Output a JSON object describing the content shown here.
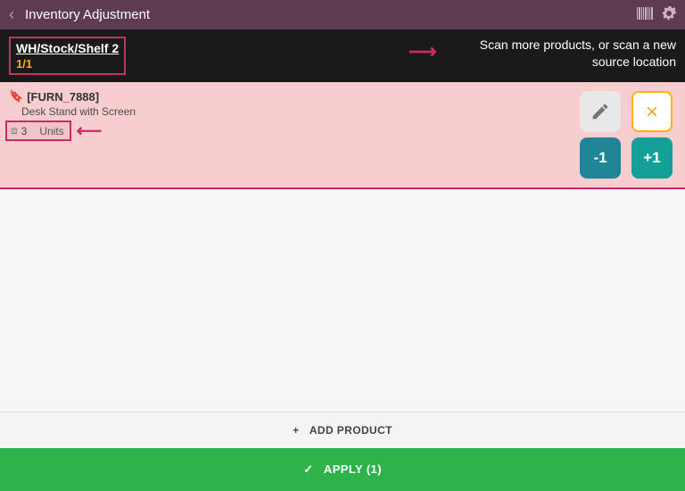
{
  "header": {
    "title": "Inventory Adjustment"
  },
  "subheader": {
    "location": "WH/Stock/Shelf 2",
    "count": "1/1",
    "scan_hint": "Scan more products, or scan a new source location"
  },
  "product": {
    "ref": "[FURN_7888]",
    "name": "Desk Stand with Screen",
    "qty": "3",
    "uom": "Units",
    "minus_label": "-1",
    "plus_label": "+1"
  },
  "footer": {
    "add_product_label": "ADD PRODUCT",
    "apply_label": "APPLY (1)"
  }
}
